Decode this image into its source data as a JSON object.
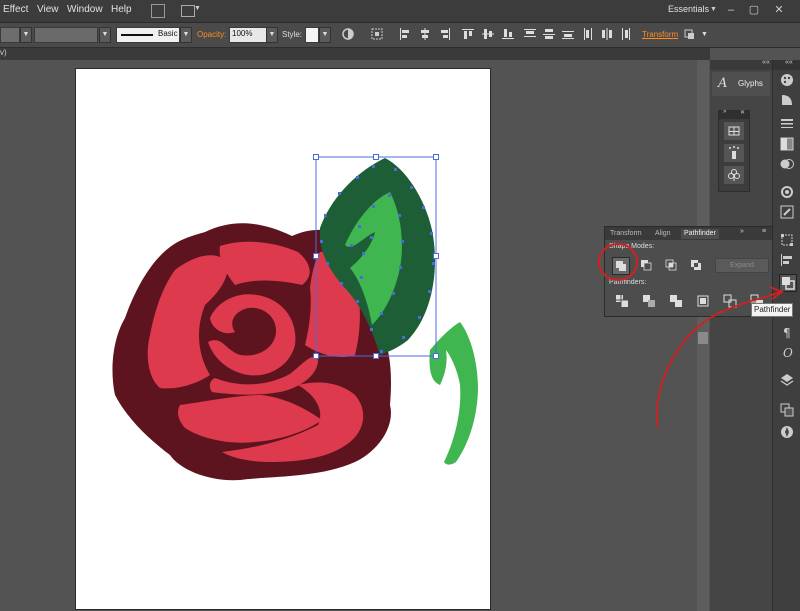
{
  "menu": {
    "items": [
      "Effect",
      "View",
      "Window",
      "Help"
    ],
    "workspace": "Essentials"
  },
  "control_bar": {
    "stroke_style": "Basic",
    "opacity_label": "Opacity:",
    "opacity_value": "100%",
    "style_label": "Style:",
    "transform_link": "Transform"
  },
  "doc_tab": {
    "label": "v)"
  },
  "right_dock": {
    "glyphs_label": "Glyphs"
  },
  "pathfinder_panel": {
    "tabs": [
      "Transform",
      "Align",
      "Pathfinder"
    ],
    "active_tab": "Pathfinder",
    "shape_modes_label": "Shape Modes:",
    "expand_label": "Expand",
    "pathfinders_label": "Pathfinders:"
  },
  "tooltip": "Pathfinder",
  "colors": {
    "rose_dark": "#5e141f",
    "rose_light": "#de3a4e",
    "leaf_dark": "#1e5e37",
    "leaf_light": "#3fb64f",
    "selection": "#4a6be0",
    "annotation": "#d32020",
    "accent": "#ff8c22"
  }
}
